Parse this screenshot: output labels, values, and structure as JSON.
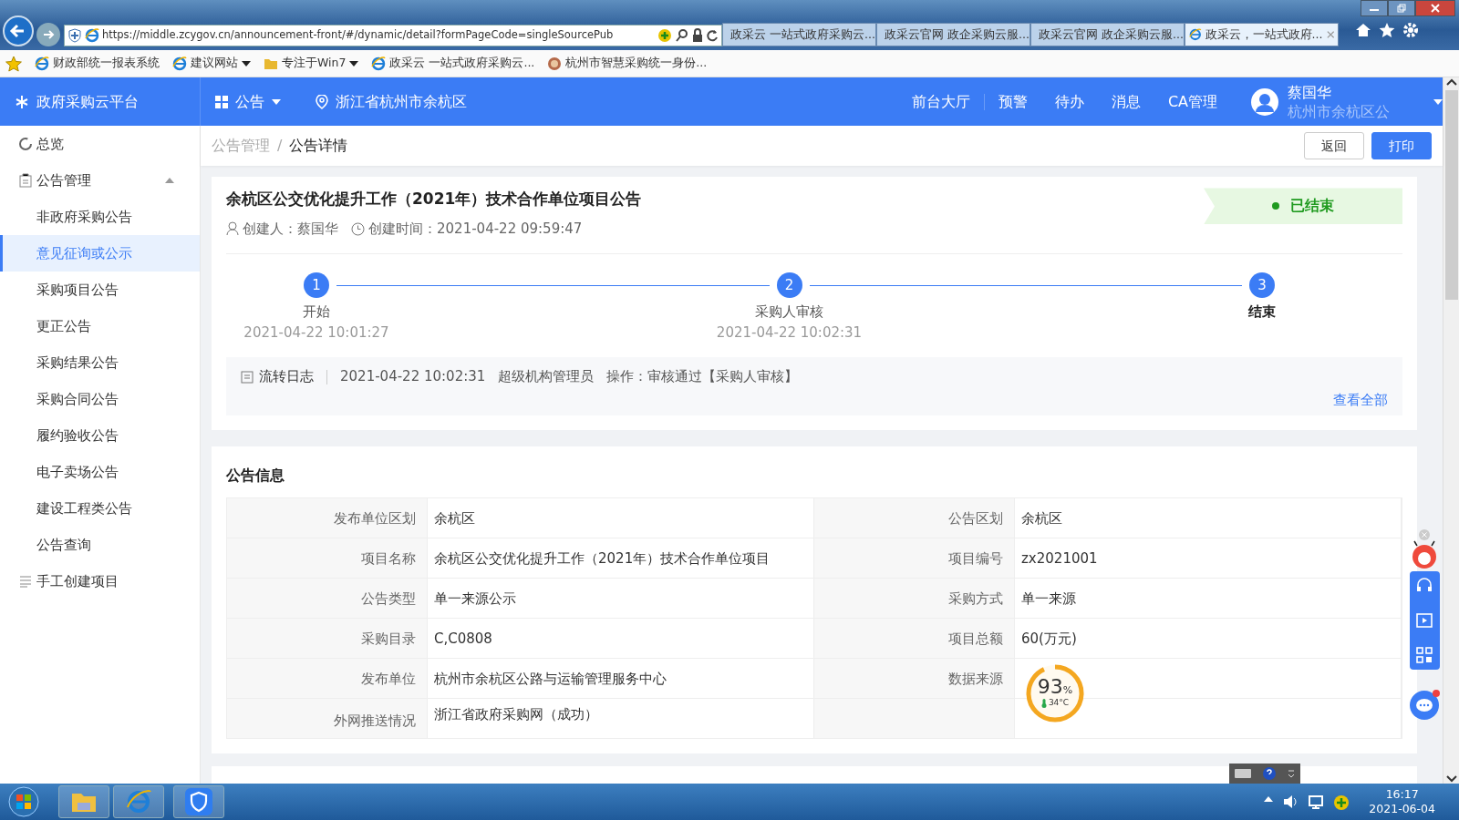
{
  "browser": {
    "address": "https://middle.zcygov.cn/announcement-front/#/dynamic/detail?formPageCode=singleSourcePub",
    "tabs": [
      {
        "label": "政采云 一站式政府采购云...",
        "selected": false
      },
      {
        "label": "政采云官网 政企采购云服...",
        "selected": false
      },
      {
        "label": "政采云官网 政企采购云服...",
        "selected": false
      },
      {
        "label": "政采云，一站式政府...",
        "selected": true
      }
    ],
    "favorites": [
      {
        "label": "财政部统一报表系统",
        "kind": "page",
        "dropdown": false
      },
      {
        "label": "建议网站",
        "kind": "page",
        "dropdown": true
      },
      {
        "label": "专注于Win7",
        "kind": "folder",
        "dropdown": true
      },
      {
        "label": "政采云 一站式政府采购云...",
        "kind": "page",
        "dropdown": false
      },
      {
        "label": "杭州市智慧采购统一身份...",
        "kind": "seal",
        "dropdown": false
      }
    ]
  },
  "app": {
    "brand": "政府采购云平台",
    "menu": "公告",
    "location": "浙江省杭州市余杭区",
    "nav_links": [
      "前台大厅",
      "预警",
      "待办",
      "消息",
      "CA管理"
    ],
    "user": {
      "name": "蔡国华",
      "org": "杭州市余杭区公"
    }
  },
  "sidebar": {
    "items": [
      {
        "label": "总览",
        "selected": false
      },
      {
        "label": "公告管理",
        "selected": false,
        "expanded": true,
        "children": [
          {
            "label": "非政府采购公告",
            "selected": false
          },
          {
            "label": "意见征询或公示",
            "selected": true
          },
          {
            "label": "采购项目公告",
            "selected": false
          },
          {
            "label": "更正公告",
            "selected": false
          },
          {
            "label": "采购结果公告",
            "selected": false
          },
          {
            "label": "采购合同公告",
            "selected": false
          },
          {
            "label": "履约验收公告",
            "selected": false
          },
          {
            "label": "电子卖场公告",
            "selected": false
          },
          {
            "label": "建设工程类公告",
            "selected": false
          },
          {
            "label": "公告查询",
            "selected": false
          }
        ]
      },
      {
        "label": "手工创建项目",
        "selected": false
      }
    ]
  },
  "breadcrumb": {
    "items": [
      "公告管理",
      "公告详情"
    ],
    "separator": "/"
  },
  "actions": [
    {
      "label": "返回",
      "kind": "default"
    },
    {
      "label": "打印",
      "kind": "primary"
    }
  ],
  "notice": {
    "title": "余杭区公交优化提升工作（2021年）技术合作单位项目公告",
    "creator": "创建人：蔡国华",
    "created": "创建时间：2021-04-22 09:59:47",
    "status": {
      "label": "已结束",
      "kind": "ended"
    },
    "steps": [
      {
        "number": "1",
        "label": "开始",
        "time": "2021-04-22 10:01:27",
        "current": false
      },
      {
        "number": "2",
        "label": "采购人审核",
        "time": "2021-04-22 10:02:31",
        "current": false
      },
      {
        "number": "3",
        "label": "结束",
        "current": true
      }
    ],
    "log": {
      "label": "流转日志",
      "time": "2021-04-22 10:02:31",
      "operator": "超级机构管理员",
      "action": "操作：审核通过【采购人审核】",
      "link": "查看全部"
    }
  },
  "info": {
    "title": "公告信息",
    "rows": [
      [
        {
          "label": "发布单位区划",
          "value": "余杭区"
        },
        {
          "label": "公告区划",
          "value": "余杭区"
        }
      ],
      [
        {
          "label": "项目名称",
          "value": "余杭区公交优化提升工作（2021年）技术合作单位项目"
        },
        {
          "label": "项目编号",
          "value": "zx2021001"
        }
      ],
      [
        {
          "label": "公告类型",
          "value": "单一来源公示"
        },
        {
          "label": "采购方式",
          "value": "单一来源"
        }
      ],
      [
        {
          "label": "采购目录",
          "value": "C,C0808"
        },
        {
          "label": "项目总额",
          "value": "60(万元)"
        }
      ],
      [
        {
          "label": "发布单位",
          "value": "杭州市余杭区公路与运输管理服务中心"
        },
        {
          "label": "数据来源"
        }
      ],
      [
        {
          "label": "外网推送情况",
          "value": "浙江省政府采购网（成功）"
        },
        {}
      ]
    ]
  },
  "meter": {
    "reading": "93",
    "unit": "%",
    "temperature": "34°C",
    "level": 0.93
  },
  "taskbar": {
    "time": "16:17",
    "date": "2021-06-04"
  }
}
